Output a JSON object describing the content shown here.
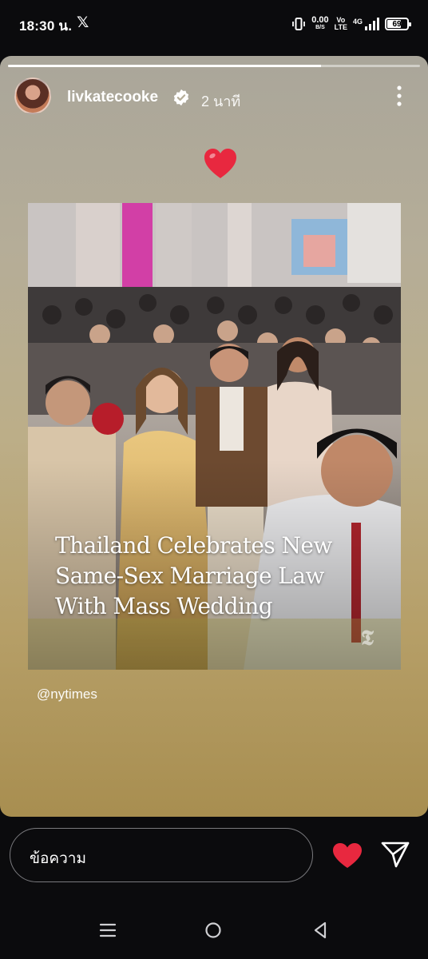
{
  "status_bar": {
    "time": "18:30 น.",
    "x_app": "𝕏",
    "net_speed_value": "0.00",
    "net_speed_unit": "B/S",
    "volte_top": "Vo",
    "volte_bottom": "LTE",
    "network": "4G",
    "battery": "69",
    "battery_level": 0.69
  },
  "story": {
    "progress": 0.76,
    "username": "livkatecooke",
    "time_ago": "2 นาที",
    "mention": "@nytimes",
    "post": {
      "headline_line1": "Thailand Celebrates New",
      "headline_line2": "Same-Sex Marriage Law",
      "headline_line3": "With Mass Wedding",
      "source_logo": "𝕿"
    }
  },
  "reply_bar": {
    "placeholder": "ข้อความ"
  },
  "colors": {
    "heart": "#e8283f",
    "background": "#0b0b0d"
  }
}
